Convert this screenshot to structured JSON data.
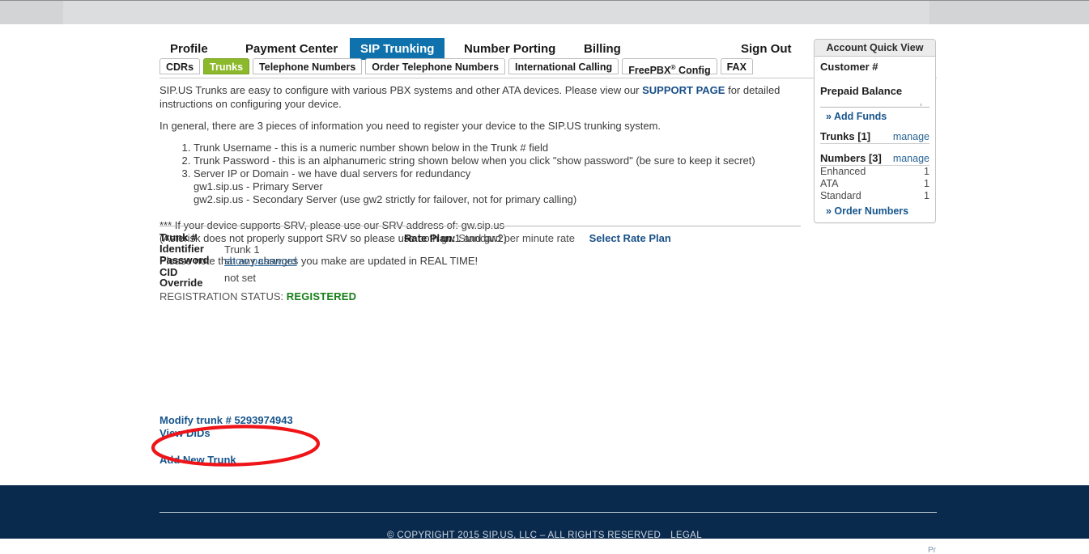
{
  "nav": {
    "primary": [
      {
        "label": "Profile",
        "active": false
      },
      {
        "label": "Payment Center",
        "active": false
      },
      {
        "label": "SIP Trunking",
        "active": true
      },
      {
        "label": "Number Porting",
        "active": false
      },
      {
        "label": "Billing",
        "active": false
      },
      {
        "label": "Sign Out",
        "active": false
      }
    ],
    "secondary": [
      {
        "label": "CDRs",
        "active": false
      },
      {
        "label": "Trunks",
        "active": true
      },
      {
        "label": "Telephone Numbers",
        "active": false
      },
      {
        "label": "Order Telephone Numbers",
        "active": false
      },
      {
        "label": "International Calling",
        "active": false
      },
      {
        "label": "FreePBX Config",
        "active": false
      },
      {
        "label": "FAX",
        "active": false
      }
    ],
    "freepbx_prefix": "FreePBX",
    "freepbx_sup": "®",
    "freepbx_suffix": " Config"
  },
  "intro": {
    "p1_before": "SIP.US Trunks are easy to configure with various PBX systems and other ATA devices. Please view our ",
    "p1_link": "SUPPORT PAGE",
    "p1_after": " for detailed instructions on configuring your device.",
    "p2": "In general, there are 3 pieces of information you need to register your device to the SIP.US trunking system.",
    "steps": [
      "Trunk Username - this is a numeric number shown below in the Trunk # field",
      "Trunk Password - this is an alphanumeric string shown below when you click \"show password\" (be sure to keep it secret)",
      "Server IP or Domain - we have dual servers for redundancy"
    ],
    "server_primary": "gw1.sip.us - Primary Server",
    "server_secondary": "gw2.sip.us - Secondary Server (use gw2 strictly for failover, not for primary calling)",
    "srv_note": "*** If your device supports SRV, please use our SRV address of: gw.sip.us",
    "srv_note2": "(Asterisk does not properly support SRV so please use both gw1 and gw2)",
    "realtime_note": "Please note that any changes you make are updated in REAL TIME!"
  },
  "trunk": {
    "labels": {
      "number": "Trunk #",
      "identifier": "Identifier",
      "password": "Password",
      "cid_override": "CID Override"
    },
    "cid_line1": "CID",
    "cid_line2": "Override",
    "values": {
      "number": "",
      "identifier": "Trunk 1",
      "password_link": "show password",
      "cid_override": "not set"
    },
    "registration_label": "REGISTRATION STATUS:",
    "registration_value": "REGISTERED",
    "modify_link": "Modify trunk # 5293974943",
    "view_dids_link": "View DIDs",
    "add_new_link": "Add New Trunk"
  },
  "rate_plan": {
    "label": "Rate Plan:",
    "value": "Standard per minute rate",
    "link": "Select Rate Plan"
  },
  "account_quick_view": {
    "title": "Account Quick View",
    "customer_label": "Customer #",
    "customer_value": "",
    "prepaid_label": "Prepaid Balance",
    "prepaid_value": "",
    "add_funds": "» Add Funds",
    "trunks_label": "Trunks [1]",
    "trunks_manage": "manage",
    "numbers_label": "Numbers [3]",
    "numbers_manage": "manage",
    "number_types": [
      {
        "name": "Enhanced",
        "count": "1"
      },
      {
        "name": "ATA",
        "count": "1"
      },
      {
        "name": "Standard",
        "count": "1"
      }
    ],
    "order_numbers": "» Order Numbers"
  },
  "footer": {
    "copyright": "© COPYRIGHT 2015 SIP.US, LLC – ALL RIGHTS RESERVED",
    "legal": "LEGAL",
    "partial": "Pr"
  },
  "annotation": {
    "shape": "ellipse",
    "color": "#ee1418",
    "stroke_width": 4,
    "target": "Modify trunk # 5293974943"
  },
  "colors": {
    "nav_active": "#0f72ac",
    "tab_active": "#8cb82b",
    "link": "#17558c",
    "footer_bg": "#0a2a4d",
    "registered": "#167f17",
    "annotation_red": "#ee1418"
  }
}
